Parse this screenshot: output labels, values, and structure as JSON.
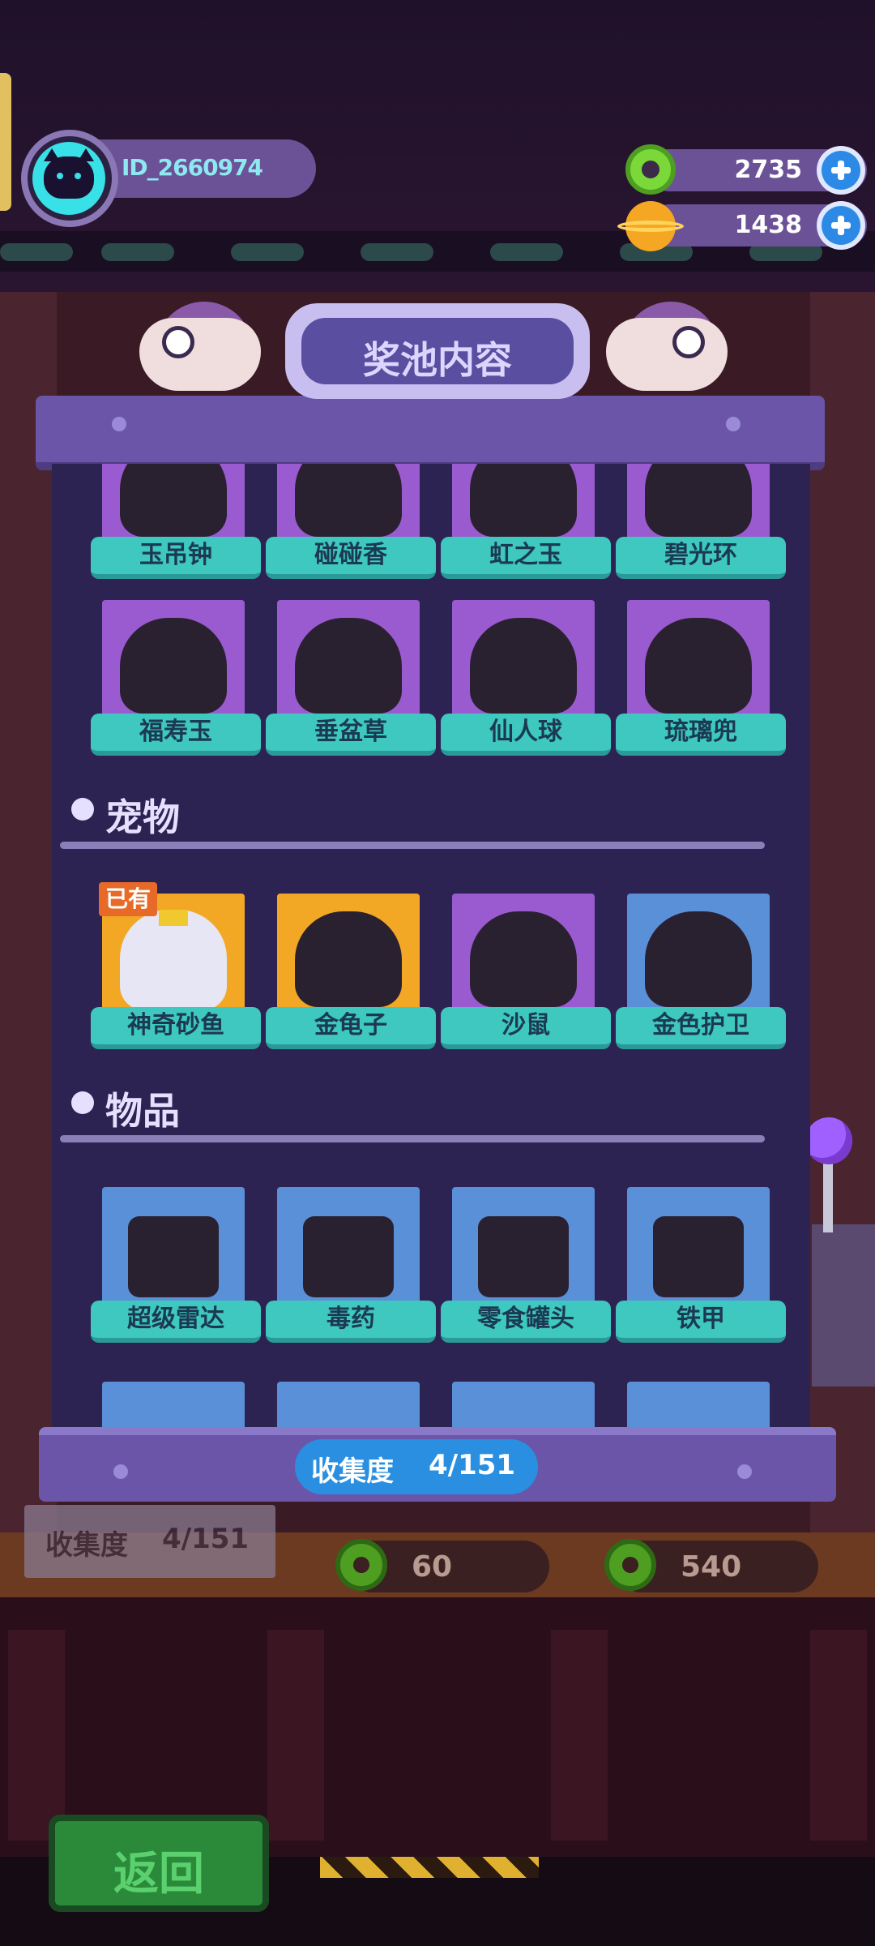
{
  "hud": {
    "player_id": "ID_2660974",
    "avatar_icon": "cat-face-icon",
    "currencies": [
      {
        "icon": "donut-icon",
        "value": "2735"
      },
      {
        "icon": "planet-icon",
        "value": "1438"
      }
    ]
  },
  "popup": {
    "title": "奖池内容",
    "sections": [
      {
        "title": "",
        "cards": [
          {
            "label": "玉吊钟",
            "bg": "#9a5ad0"
          },
          {
            "label": "碰碰香",
            "bg": "#9a5ad0"
          },
          {
            "label": "虹之玉",
            "bg": "#9a5ad0"
          },
          {
            "label": "碧光环",
            "bg": "#9a5ad0"
          },
          {
            "label": "福寿玉",
            "bg": "#9a5ad0"
          },
          {
            "label": "垂盆草",
            "bg": "#9a5ad0"
          },
          {
            "label": "仙人球",
            "bg": "#9a5ad0"
          },
          {
            "label": "琉璃兜",
            "bg": "#9a5ad0"
          }
        ]
      },
      {
        "title": "宠物",
        "cards": [
          {
            "label": "神奇砂鱼",
            "bg": "#f2a825",
            "owned": true,
            "badge": "已有"
          },
          {
            "label": "金龟子",
            "bg": "#f2a825"
          },
          {
            "label": "沙鼠",
            "bg": "#9a5ad0"
          },
          {
            "label": "金色护卫",
            "bg": "#5a90d8"
          }
        ]
      },
      {
        "title": "物品",
        "cards": [
          {
            "label": "超级雷达",
            "bg": "#5a90d8"
          },
          {
            "label": "毒药",
            "bg": "#5a90d8"
          },
          {
            "label": "零食罐头",
            "bg": "#5a90d8"
          },
          {
            "label": "铁甲",
            "bg": "#5a90d8"
          }
        ]
      }
    ],
    "collection": {
      "label": "收集度",
      "value": "4/151"
    }
  },
  "background": {
    "collection": {
      "label": "收集度",
      "value": "4/151"
    },
    "prices": [
      "60",
      "540"
    ],
    "back_button": "返回"
  }
}
